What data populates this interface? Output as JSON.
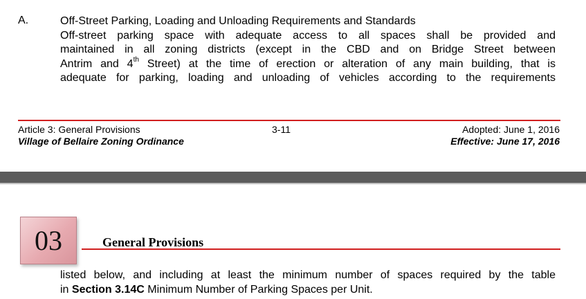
{
  "section": {
    "letter": "A.",
    "heading": "Off-Street Parking, Loading and Unloading Requirements and Standards",
    "line1": "Off-street parking space with adequate access to all spaces shall be provided and",
    "line2": "maintained in all zoning districts (except in the CBD and on Bridge Street between",
    "line3_pre": "Antrim and 4",
    "line3_sup": "th",
    "line3_post": " Street) at the time of erection or alteration of any main building, that is",
    "line4": "adequate for parking, loading and unloading of vehicles according to the requirements"
  },
  "footer": {
    "article": "Article 3: General Provisions",
    "ordinance": "Village of Bellaire Zoning Ordinance",
    "page_number": "3-11",
    "adopted": "Adopted: June 1, 2016",
    "effective": "Effective: June 17, 2016"
  },
  "chapter": {
    "number": "03",
    "title": "General Provisions"
  },
  "continuation": {
    "line1": "listed below, and including at least the minimum number of spaces required by the table",
    "line2_pre": "in ",
    "line2_bold": "Section 3.14C",
    "line2_post": " Minimum Number of Parking Spaces per Unit."
  },
  "colors": {
    "rule": "#d11f1f",
    "chapter_box": "#e7aab0",
    "page_gap": "#5c5c5c"
  }
}
